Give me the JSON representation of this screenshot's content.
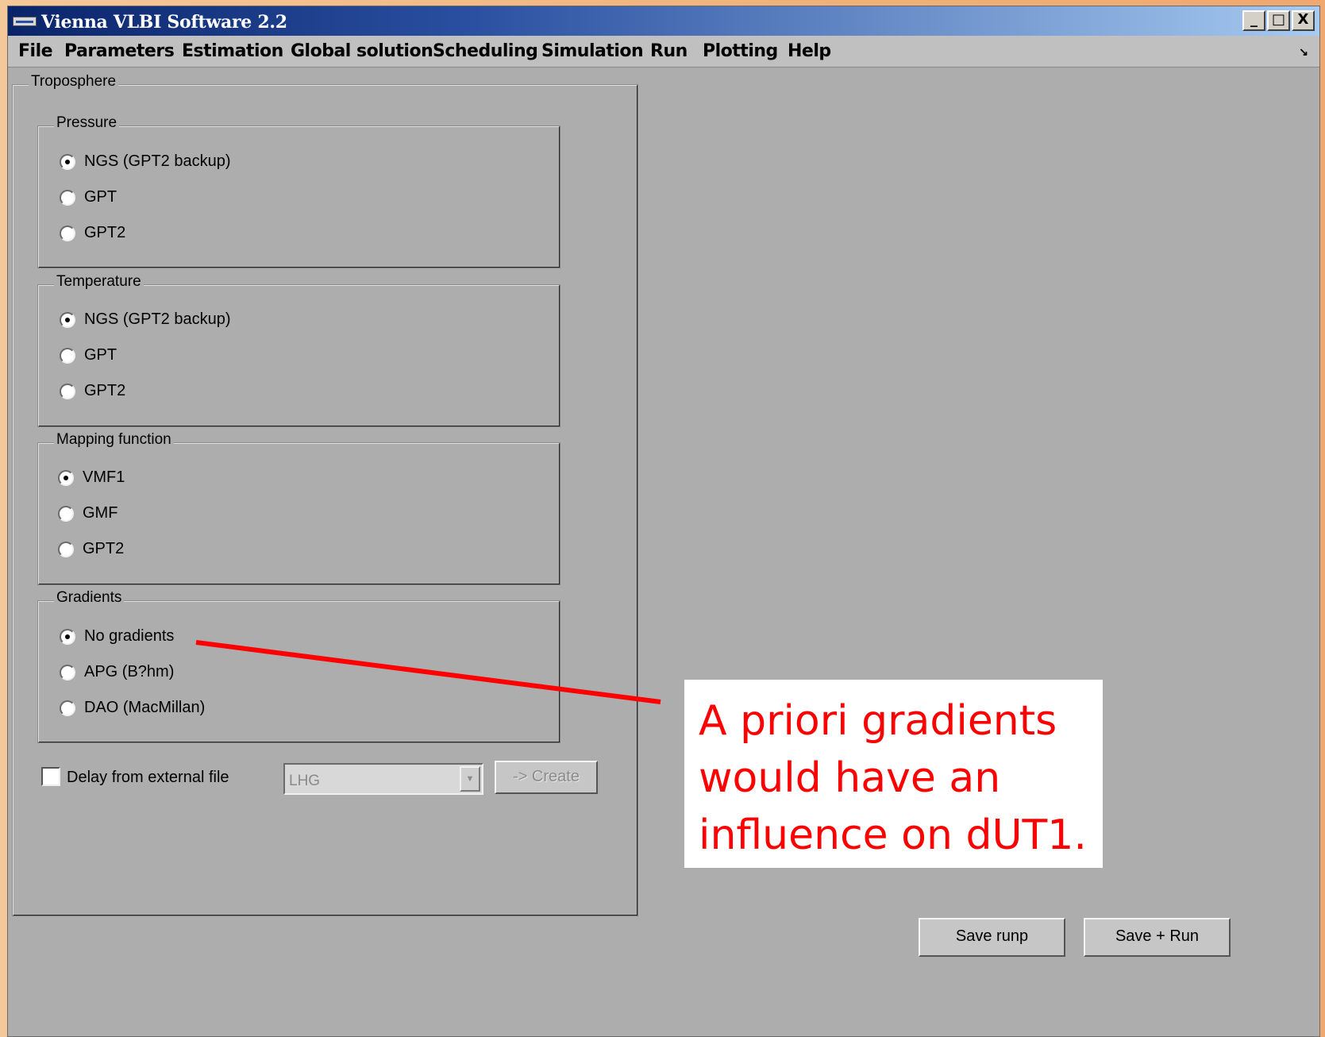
{
  "window": {
    "title": "Vienna VLBI Software 2.2",
    "controls": {
      "minimize": "_",
      "maximize": "□",
      "close": "X"
    }
  },
  "menu": {
    "items": [
      "File",
      "Parameters",
      "Estimation",
      "Global solution",
      "Scheduling",
      "Simulation",
      "Run",
      "Plotting",
      "Help"
    ],
    "dock_arrow": "↘"
  },
  "troposphere": {
    "title": "Troposphere",
    "pressure": {
      "title": "Pressure",
      "options": [
        "NGS (GPT2 backup)",
        "GPT",
        "GPT2"
      ],
      "selected": "NGS (GPT2 backup)"
    },
    "temperature": {
      "title": "Temperature",
      "options": [
        "NGS (GPT2 backup)",
        "GPT",
        "GPT2"
      ],
      "selected": "NGS (GPT2 backup)"
    },
    "mapping_function": {
      "title": "Mapping function",
      "options": [
        "VMF1",
        "GMF",
        "GPT2"
      ],
      "selected": "VMF1"
    },
    "gradients": {
      "title": "Gradients",
      "options": [
        "No gradients",
        "APG (B?hm)",
        "DAO (MacMillan)"
      ],
      "selected": "No gradients"
    },
    "external_delay": {
      "label": "Delay from external file",
      "checked": false,
      "combo_value": "LHG",
      "create_label": "-> Create"
    }
  },
  "buttons": {
    "save_runp": "Save runp",
    "save_run": "Save + Run"
  },
  "annotation": {
    "text": "A priori gradients would have an influence on dUT1.",
    "color": "#ff0000"
  }
}
